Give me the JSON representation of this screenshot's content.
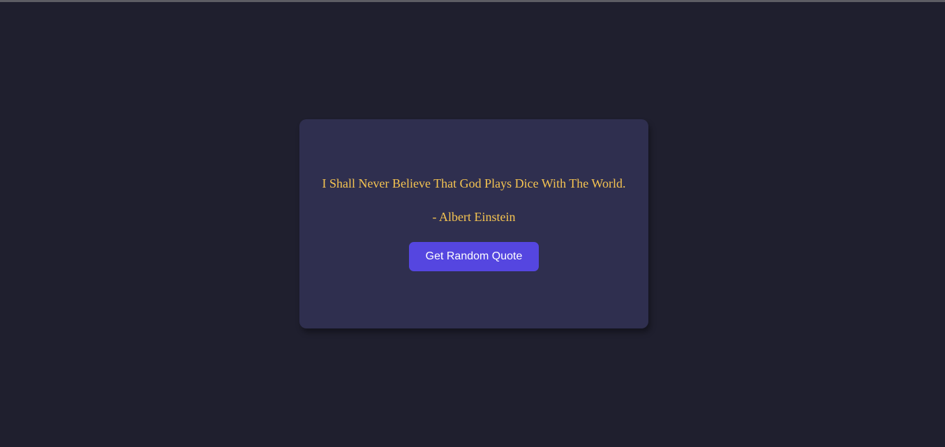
{
  "quote": {
    "text": "I Shall Never Believe That God Plays Dice With The World.",
    "author": "- Albert Einstein"
  },
  "actions": {
    "button_label": "Get Random Quote"
  },
  "colors": {
    "background": "#1f1f2e",
    "card": "#2f2f4f",
    "quote_text": "#f5c451",
    "button": "#5546e0",
    "button_text": "#ffffff",
    "top_divider": "#5d5d64"
  }
}
